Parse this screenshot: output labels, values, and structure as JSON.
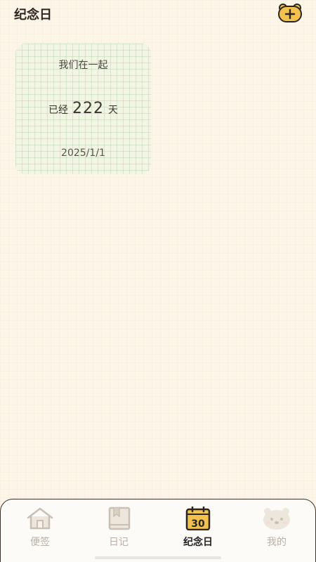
{
  "header": {
    "title": "纪念日",
    "add_icon": "bear-plus-icon"
  },
  "anniversary_card": {
    "title": "我们在一起",
    "prefix": "已经",
    "days": "222",
    "suffix": "天",
    "date": "2025/1/1"
  },
  "tabbar": {
    "tabs": [
      {
        "label": "便签",
        "icon": "house-icon",
        "active": false
      },
      {
        "label": "日记",
        "icon": "book-icon",
        "active": false
      },
      {
        "label": "纪念日",
        "icon": "calendar-30-icon",
        "calendar_text": "30",
        "active": true
      },
      {
        "label": "我的",
        "icon": "bear-face-icon",
        "active": false
      }
    ]
  },
  "colors": {
    "background": "#fdf5e8",
    "card": "#f3f5e4",
    "active_icon": "#f2c14e",
    "inactive_label": "#b8b0a6"
  }
}
